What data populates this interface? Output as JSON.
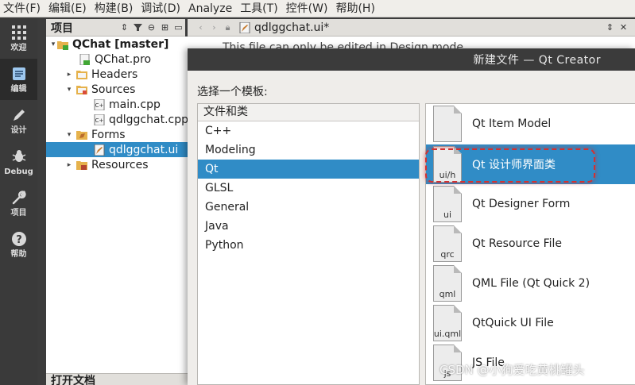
{
  "menubar": [
    "文件(F)",
    "编辑(E)",
    "构建(B)",
    "调试(D)",
    "Analyze",
    "工具(T)",
    "控件(W)",
    "帮助(H)"
  ],
  "modes": [
    {
      "label": "欢迎",
      "icon": "grid-icon"
    },
    {
      "label": "编辑",
      "icon": "document-edit-icon"
    },
    {
      "label": "设计",
      "icon": "pencil-icon"
    },
    {
      "label": "Debug",
      "icon": "bug-icon"
    },
    {
      "label": "项目",
      "icon": "wrench-icon"
    },
    {
      "label": "帮助",
      "icon": "help-icon"
    }
  ],
  "project": {
    "title": "项目",
    "tree": [
      {
        "label": "QChat [master]",
        "level": 0,
        "expander": "▾"
      },
      {
        "label": "QChat.pro",
        "level": 1,
        "expander": ""
      },
      {
        "label": "Headers",
        "level": 1,
        "expander": "▸"
      },
      {
        "label": "Sources",
        "level": 1,
        "expander": "▾"
      },
      {
        "label": "main.cpp",
        "level": 2,
        "expander": ""
      },
      {
        "label": "qdlggchat.cpp",
        "level": 2,
        "expander": ""
      },
      {
        "label": "Forms",
        "level": 1,
        "expander": "▾"
      },
      {
        "label": "qdlggchat.ui",
        "level": 2,
        "expander": ""
      },
      {
        "label": "Resources",
        "level": 1,
        "expander": "▸"
      }
    ],
    "open_documents": "打开文档"
  },
  "editor": {
    "file_tab": "qdlggchat.ui*",
    "peek_text": "This file can only be edited in Design mode"
  },
  "dialog": {
    "title": "新建文件 — Qt Creator",
    "prompt": "选择一个模板:",
    "category_header": "文件和类",
    "categories": [
      "C++",
      "Modeling",
      "Qt",
      "GLSL",
      "General",
      "Java",
      "Python"
    ],
    "selected_category": "Qt",
    "templates": [
      {
        "label": "Qt Item Model",
        "badge": ""
      },
      {
        "label": "Qt 设计师界面类",
        "badge": "ui/h"
      },
      {
        "label": "Qt Designer Form",
        "badge": "ui"
      },
      {
        "label": "Qt Resource File",
        "badge": "qrc"
      },
      {
        "label": "QML File (Qt Quick 2)",
        "badge": "qml"
      },
      {
        "label": "QtQuick UI File",
        "badge": "ui.qml"
      },
      {
        "label": "JS File",
        "badge": "js"
      }
    ],
    "selected_template": "Qt 设计师界面类"
  },
  "watermark": "CSDN @小狗爱吃黄桃罐头",
  "colors": {
    "selection": "#308cc6",
    "highlight_border": "#d43030"
  }
}
